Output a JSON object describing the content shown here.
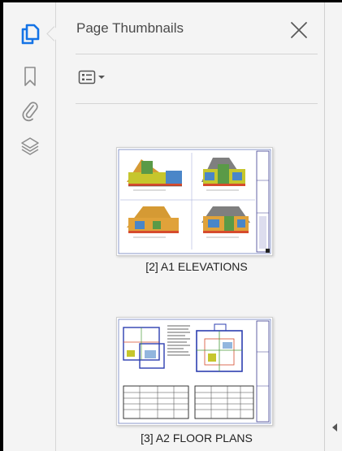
{
  "panel": {
    "title": "Page Thumbnails",
    "thumbnails": [
      {
        "label": "[2] A1 ELEVATIONS"
      },
      {
        "label": "[3] A2 FLOOR PLANS"
      }
    ]
  },
  "rail": {
    "items": [
      {
        "icon": "page-thumbnails-icon",
        "active": true
      },
      {
        "icon": "bookmark-icon",
        "active": false
      },
      {
        "icon": "attachment-icon",
        "active": false
      },
      {
        "icon": "layers-icon",
        "active": false
      }
    ]
  },
  "colors": {
    "accent": "#1473e6",
    "icon_gray": "#8c8c8c"
  }
}
